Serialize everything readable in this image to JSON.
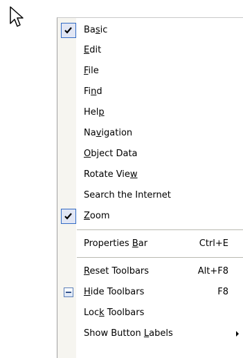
{
  "cursor": {
    "icon": "arrow-pointer-icon"
  },
  "menu": {
    "items": [
      {
        "label": "Basic",
        "mnemonic": "s",
        "checked": true
      },
      {
        "label": "Edit",
        "mnemonic": "E",
        "checked": false
      },
      {
        "label": "File",
        "mnemonic": "F",
        "checked": false
      },
      {
        "label": "Find",
        "mnemonic": "n",
        "checked": false
      },
      {
        "label": "Help",
        "mnemonic": "p",
        "checked": false
      },
      {
        "label": "Navigation",
        "mnemonic": "v",
        "checked": false
      },
      {
        "label": "Object Data",
        "mnemonic": "O",
        "checked": false
      },
      {
        "label": "Rotate View",
        "mnemonic": "w",
        "checked": false
      },
      {
        "label": "Search the Internet",
        "mnemonic": "",
        "checked": false
      },
      {
        "label": "Zoom",
        "mnemonic": "Z",
        "checked": true
      }
    ],
    "properties_bar": {
      "label": "Properties Bar",
      "mnemonic": "B",
      "shortcut": "Ctrl+E"
    },
    "reset_toolbars": {
      "label": "Reset Toolbars",
      "mnemonic": "R",
      "shortcut": "Alt+F8"
    },
    "hide_toolbars": {
      "label": "Hide Toolbars",
      "mnemonic": "H",
      "shortcut": "F8",
      "icon": "hide-toolbars-icon"
    },
    "lock_toolbars": {
      "label": "Lock Toolbars",
      "mnemonic": "k",
      "shortcut": ""
    },
    "show_button_labels": {
      "label": "Show Button Labels",
      "mnemonic": "L",
      "submenu": true
    }
  }
}
